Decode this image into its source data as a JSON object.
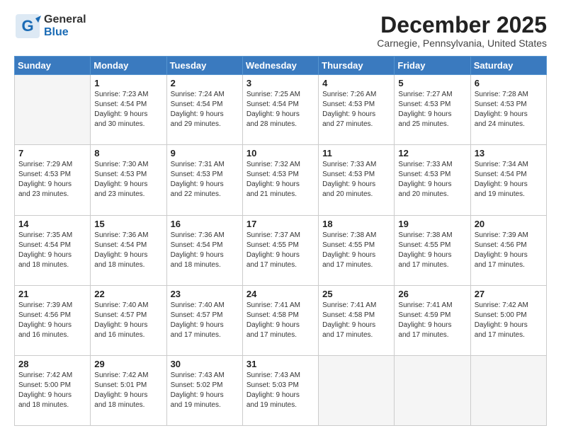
{
  "logo": {
    "line1": "General",
    "line2": "Blue"
  },
  "title": "December 2025",
  "location": "Carnegie, Pennsylvania, United States",
  "days_header": [
    "Sunday",
    "Monday",
    "Tuesday",
    "Wednesday",
    "Thursday",
    "Friday",
    "Saturday"
  ],
  "weeks": [
    [
      {
        "day": "",
        "info": ""
      },
      {
        "day": "1",
        "info": "Sunrise: 7:23 AM\nSunset: 4:54 PM\nDaylight: 9 hours\nand 30 minutes."
      },
      {
        "day": "2",
        "info": "Sunrise: 7:24 AM\nSunset: 4:54 PM\nDaylight: 9 hours\nand 29 minutes."
      },
      {
        "day": "3",
        "info": "Sunrise: 7:25 AM\nSunset: 4:54 PM\nDaylight: 9 hours\nand 28 minutes."
      },
      {
        "day": "4",
        "info": "Sunrise: 7:26 AM\nSunset: 4:53 PM\nDaylight: 9 hours\nand 27 minutes."
      },
      {
        "day": "5",
        "info": "Sunrise: 7:27 AM\nSunset: 4:53 PM\nDaylight: 9 hours\nand 25 minutes."
      },
      {
        "day": "6",
        "info": "Sunrise: 7:28 AM\nSunset: 4:53 PM\nDaylight: 9 hours\nand 24 minutes."
      }
    ],
    [
      {
        "day": "7",
        "info": "Sunrise: 7:29 AM\nSunset: 4:53 PM\nDaylight: 9 hours\nand 23 minutes."
      },
      {
        "day": "8",
        "info": "Sunrise: 7:30 AM\nSunset: 4:53 PM\nDaylight: 9 hours\nand 23 minutes."
      },
      {
        "day": "9",
        "info": "Sunrise: 7:31 AM\nSunset: 4:53 PM\nDaylight: 9 hours\nand 22 minutes."
      },
      {
        "day": "10",
        "info": "Sunrise: 7:32 AM\nSunset: 4:53 PM\nDaylight: 9 hours\nand 21 minutes."
      },
      {
        "day": "11",
        "info": "Sunrise: 7:33 AM\nSunset: 4:53 PM\nDaylight: 9 hours\nand 20 minutes."
      },
      {
        "day": "12",
        "info": "Sunrise: 7:33 AM\nSunset: 4:53 PM\nDaylight: 9 hours\nand 20 minutes."
      },
      {
        "day": "13",
        "info": "Sunrise: 7:34 AM\nSunset: 4:54 PM\nDaylight: 9 hours\nand 19 minutes."
      }
    ],
    [
      {
        "day": "14",
        "info": "Sunrise: 7:35 AM\nSunset: 4:54 PM\nDaylight: 9 hours\nand 18 minutes."
      },
      {
        "day": "15",
        "info": "Sunrise: 7:36 AM\nSunset: 4:54 PM\nDaylight: 9 hours\nand 18 minutes."
      },
      {
        "day": "16",
        "info": "Sunrise: 7:36 AM\nSunset: 4:54 PM\nDaylight: 9 hours\nand 18 minutes."
      },
      {
        "day": "17",
        "info": "Sunrise: 7:37 AM\nSunset: 4:55 PM\nDaylight: 9 hours\nand 17 minutes."
      },
      {
        "day": "18",
        "info": "Sunrise: 7:38 AM\nSunset: 4:55 PM\nDaylight: 9 hours\nand 17 minutes."
      },
      {
        "day": "19",
        "info": "Sunrise: 7:38 AM\nSunset: 4:55 PM\nDaylight: 9 hours\nand 17 minutes."
      },
      {
        "day": "20",
        "info": "Sunrise: 7:39 AM\nSunset: 4:56 PM\nDaylight: 9 hours\nand 17 minutes."
      }
    ],
    [
      {
        "day": "21",
        "info": "Sunrise: 7:39 AM\nSunset: 4:56 PM\nDaylight: 9 hours\nand 16 minutes."
      },
      {
        "day": "22",
        "info": "Sunrise: 7:40 AM\nSunset: 4:57 PM\nDaylight: 9 hours\nand 16 minutes."
      },
      {
        "day": "23",
        "info": "Sunrise: 7:40 AM\nSunset: 4:57 PM\nDaylight: 9 hours\nand 17 minutes."
      },
      {
        "day": "24",
        "info": "Sunrise: 7:41 AM\nSunset: 4:58 PM\nDaylight: 9 hours\nand 17 minutes."
      },
      {
        "day": "25",
        "info": "Sunrise: 7:41 AM\nSunset: 4:58 PM\nDaylight: 9 hours\nand 17 minutes."
      },
      {
        "day": "26",
        "info": "Sunrise: 7:41 AM\nSunset: 4:59 PM\nDaylight: 9 hours\nand 17 minutes."
      },
      {
        "day": "27",
        "info": "Sunrise: 7:42 AM\nSunset: 5:00 PM\nDaylight: 9 hours\nand 17 minutes."
      }
    ],
    [
      {
        "day": "28",
        "info": "Sunrise: 7:42 AM\nSunset: 5:00 PM\nDaylight: 9 hours\nand 18 minutes."
      },
      {
        "day": "29",
        "info": "Sunrise: 7:42 AM\nSunset: 5:01 PM\nDaylight: 9 hours\nand 18 minutes."
      },
      {
        "day": "30",
        "info": "Sunrise: 7:43 AM\nSunset: 5:02 PM\nDaylight: 9 hours\nand 19 minutes."
      },
      {
        "day": "31",
        "info": "Sunrise: 7:43 AM\nSunset: 5:03 PM\nDaylight: 9 hours\nand 19 minutes."
      },
      {
        "day": "",
        "info": ""
      },
      {
        "day": "",
        "info": ""
      },
      {
        "day": "",
        "info": ""
      }
    ]
  ]
}
